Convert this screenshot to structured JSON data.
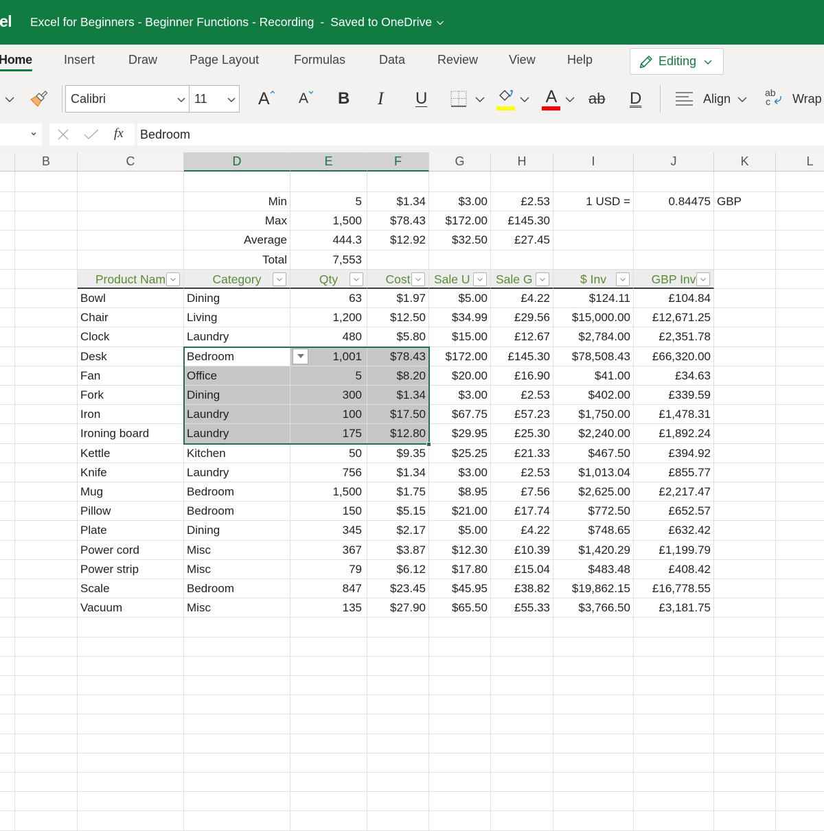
{
  "title_bar": {
    "app_name_fragment": "el",
    "document_title": "Excel for Beginners - Beginner Functions - Recording",
    "separator": "-",
    "save_status": "Saved to OneDrive"
  },
  "ribbon": {
    "tabs": [
      {
        "label": "Home",
        "active": true
      },
      {
        "label": "Insert",
        "active": false
      },
      {
        "label": "Draw",
        "active": false
      },
      {
        "label": "Page Layout",
        "active": false
      },
      {
        "label": "Formulas",
        "active": false
      },
      {
        "label": "Data",
        "active": false
      },
      {
        "label": "Review",
        "active": false
      },
      {
        "label": "View",
        "active": false
      },
      {
        "label": "Help",
        "active": false
      }
    ],
    "mode_button": "Editing"
  },
  "toolbar": {
    "font_name": "Calibri",
    "font_size": "11",
    "align_label": "Align",
    "wrap_label": "Wrap",
    "icons": {
      "grow_font": "A",
      "shrink_font": "A",
      "bold": "B",
      "italic": "I",
      "underline": "U",
      "font_color": "A",
      "strikethrough": "ab",
      "double_underline": "D",
      "wrap_top": "ab",
      "wrap_bottom": "c"
    }
  },
  "formula_bar": {
    "name_box": "",
    "function_icon": "fx",
    "formula": "Bedroom"
  },
  "sheet": {
    "columns": [
      "B",
      "C",
      "D",
      "E",
      "F",
      "G",
      "H",
      "I",
      "J",
      "K",
      "L"
    ],
    "selected_columns": [
      "D",
      "E",
      "F"
    ],
    "selection": {
      "columns": [
        "D",
        "E",
        "F"
      ],
      "table_row_start": 3,
      "table_row_end": 7,
      "active_column": "D",
      "active_table_row": 3
    }
  },
  "summary": {
    "rows": [
      {
        "label": "Min",
        "qty": "5",
        "cost": "$1.34",
        "sale_usd": "$3.00",
        "sale_gbp": "£2.53"
      },
      {
        "label": "Max",
        "qty": "1,500",
        "cost": "$78.43",
        "sale_usd": "$172.00",
        "sale_gbp": "£145.30"
      },
      {
        "label": "Average",
        "qty": "444.3",
        "cost": "$12.92",
        "sale_usd": "$32.50",
        "sale_gbp": "£27.45"
      },
      {
        "label": "Total",
        "qty": "7,553"
      }
    ],
    "exchange_rate": {
      "label": "1 USD =",
      "rate": "0.84475",
      "currency": "GBP"
    }
  },
  "table": {
    "headers": [
      "Product Nam",
      "Category",
      "Qty",
      "Cost",
      "Sale U",
      "Sale G",
      "$ Inv",
      "GBP Inv"
    ],
    "rows": [
      {
        "product": "Bowl",
        "category": "Dining",
        "qty": "63",
        "cost": "$1.97",
        "sale_usd": "$5.00",
        "sale_gbp": "£4.22",
        "usd_inv": "$124.11",
        "gbp_inv": "£104.84"
      },
      {
        "product": "Chair",
        "category": "Living",
        "qty": "1,200",
        "cost": "$12.50",
        "sale_usd": "$34.99",
        "sale_gbp": "£29.56",
        "usd_inv": "$15,000.00",
        "gbp_inv": "£12,671.25"
      },
      {
        "product": "Clock",
        "category": "Laundry",
        "qty": "480",
        "cost": "$5.80",
        "sale_usd": "$15.00",
        "sale_gbp": "£12.67",
        "usd_inv": "$2,784.00",
        "gbp_inv": "£2,351.78"
      },
      {
        "product": "Desk",
        "category": "Bedroom",
        "qty": "1,001",
        "cost": "$78.43",
        "sale_usd": "$172.00",
        "sale_gbp": "£145.30",
        "usd_inv": "$78,508.43",
        "gbp_inv": "£66,320.00"
      },
      {
        "product": "Fan",
        "category": "Office",
        "qty": "5",
        "cost": "$8.20",
        "sale_usd": "$20.00",
        "sale_gbp": "£16.90",
        "usd_inv": "$41.00",
        "gbp_inv": "£34.63"
      },
      {
        "product": "Fork",
        "category": "Dining",
        "qty": "300",
        "cost": "$1.34",
        "sale_usd": "$3.00",
        "sale_gbp": "£2.53",
        "usd_inv": "$402.00",
        "gbp_inv": "£339.59"
      },
      {
        "product": "Iron",
        "category": "Laundry",
        "qty": "100",
        "cost": "$17.50",
        "sale_usd": "$67.75",
        "sale_gbp": "£57.23",
        "usd_inv": "$1,750.00",
        "gbp_inv": "£1,478.31"
      },
      {
        "product": "Ironing board",
        "category": "Laundry",
        "qty": "175",
        "cost": "$12.80",
        "sale_usd": "$29.95",
        "sale_gbp": "£25.30",
        "usd_inv": "$2,240.00",
        "gbp_inv": "£1,892.24"
      },
      {
        "product": "Kettle",
        "category": "Kitchen",
        "qty": "50",
        "cost": "$9.35",
        "sale_usd": "$25.25",
        "sale_gbp": "£21.33",
        "usd_inv": "$467.50",
        "gbp_inv": "£394.92"
      },
      {
        "product": "Knife",
        "category": "Laundry",
        "qty": "756",
        "cost": "$1.34",
        "sale_usd": "$3.00",
        "sale_gbp": "£2.53",
        "usd_inv": "$1,013.04",
        "gbp_inv": "£855.77"
      },
      {
        "product": "Mug",
        "category": "Bedroom",
        "qty": "1,500",
        "cost": "$1.75",
        "sale_usd": "$8.95",
        "sale_gbp": "£7.56",
        "usd_inv": "$2,625.00",
        "gbp_inv": "£2,217.47"
      },
      {
        "product": "Pillow",
        "category": "Bedroom",
        "qty": "150",
        "cost": "$5.15",
        "sale_usd": "$21.00",
        "sale_gbp": "£17.74",
        "usd_inv": "$772.50",
        "gbp_inv": "£652.57"
      },
      {
        "product": "Plate",
        "category": "Dining",
        "qty": "345",
        "cost": "$2.17",
        "sale_usd": "$5.00",
        "sale_gbp": "£4.22",
        "usd_inv": "$748.65",
        "gbp_inv": "£632.42"
      },
      {
        "product": "Power cord",
        "category": "Misc",
        "qty": "367",
        "cost": "$3.87",
        "sale_usd": "$12.30",
        "sale_gbp": "£10.39",
        "usd_inv": "$1,420.29",
        "gbp_inv": "£1,199.79"
      },
      {
        "product": "Power strip",
        "category": "Misc",
        "qty": "79",
        "cost": "$6.12",
        "sale_usd": "$17.80",
        "sale_gbp": "£15.04",
        "usd_inv": "$483.48",
        "gbp_inv": "£408.42"
      },
      {
        "product": "Scale",
        "category": "Bedroom",
        "qty": "847",
        "cost": "$23.45",
        "sale_usd": "$45.95",
        "sale_gbp": "£38.82",
        "usd_inv": "$19,862.15",
        "gbp_inv": "£16,778.55"
      },
      {
        "product": "Vacuum",
        "category": "Misc",
        "qty": "135",
        "cost": "$27.90",
        "sale_usd": "$65.50",
        "sale_gbp": "£55.33",
        "usd_inv": "$3,766.50",
        "gbp_inv": "£3,181.75"
      }
    ]
  },
  "colors": {
    "brand": "#107C41",
    "selection_fill": "#C6C6C6",
    "selection_border": "#217346",
    "table_header_text": "#5B8C33",
    "fill_color_swatch": "#FFFF00",
    "font_color_swatch": "#FF0000"
  }
}
